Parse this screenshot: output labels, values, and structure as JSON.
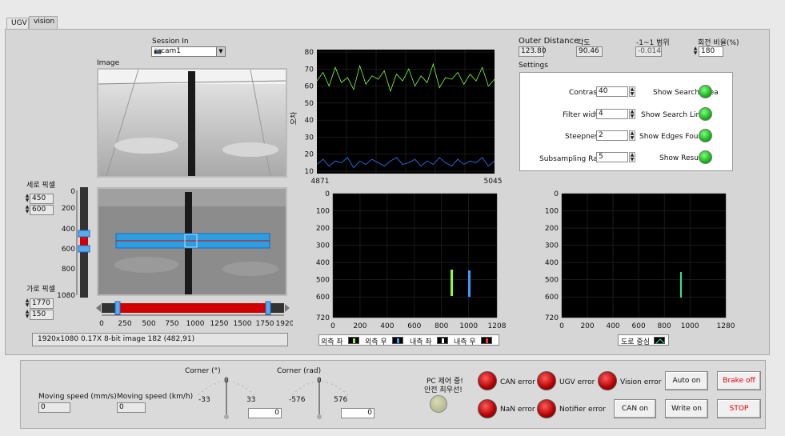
{
  "tabs": [
    {
      "label": "UGV"
    },
    {
      "label": "vision"
    }
  ],
  "session": {
    "label": "Session In",
    "value": "cam1",
    "icon": "camera-icon"
  },
  "image_label": "Image",
  "vertical_pixel": {
    "label": "세로 픽셀",
    "v1": "450",
    "v2": "600"
  },
  "horizontal_pixel": {
    "label": "가로 픽셀",
    "v1": "1770",
    "v2": "150"
  },
  "vslider": {
    "ticks": [
      "0",
      "200",
      "400",
      "600",
      "800",
      "1080"
    ]
  },
  "hslider": {
    "ticks": [
      "0",
      "250",
      "500",
      "750",
      "1000",
      "1250",
      "1500",
      "1750",
      "1920"
    ]
  },
  "status_bar": "1920x1080 0.17X 8-bit image 182    (482,91)",
  "top_chart": {
    "ylabel": "오차",
    "yticks": [
      "80",
      "70",
      "60",
      "50",
      "40",
      "30",
      "20",
      "10"
    ],
    "xmin": "4871",
    "xmax": "5045"
  },
  "chart_data": [
    {
      "type": "line",
      "ylabel": "오차",
      "ylim": [
        10,
        80
      ],
      "xlim": [
        4871,
        5045
      ],
      "series": [
        {
          "color": "#7dff3a",
          "values": [
            63,
            68,
            60,
            71,
            62,
            65,
            58,
            72,
            61,
            66,
            64,
            69,
            57,
            67,
            63,
            70,
            60,
            66,
            62,
            73,
            59,
            65,
            64,
            68,
            61,
            67,
            63,
            71,
            60,
            64
          ]
        },
        {
          "color": "#2a7dff",
          "values": [
            14,
            17,
            13,
            16,
            15,
            18,
            12,
            16,
            14,
            17,
            15,
            13,
            16,
            18,
            14,
            15,
            17,
            13,
            16,
            14,
            18,
            15,
            13,
            17,
            14,
            16,
            15,
            18,
            13,
            16
          ]
        }
      ]
    },
    {
      "type": "scatter",
      "ylim": [
        720,
        0
      ],
      "xlim": [
        0,
        1208
      ],
      "yticks": [
        "0",
        "100",
        "200",
        "300",
        "400",
        "500",
        "600",
        "720"
      ],
      "xticks": [
        "0",
        "200",
        "400",
        "600",
        "800",
        "1000",
        "1208"
      ],
      "legend": [
        "외측 좌",
        "외측 우",
        "내측 좌",
        "내측 우"
      ]
    },
    {
      "type": "scatter",
      "ylim": [
        720,
        0
      ],
      "xlim": [
        0,
        1280
      ],
      "yticks": [
        "0",
        "100",
        "200",
        "300",
        "400",
        "500",
        "600",
        "720"
      ],
      "xticks": [
        "0",
        "200",
        "400",
        "600",
        "800",
        "1000",
        "1280"
      ],
      "legend": [
        "도로 중심"
      ]
    }
  ],
  "top_right": {
    "outer_label": "Outer Distance",
    "outer_value": "123.80",
    "angle_label": "각도",
    "angle_value": "90.46",
    "range_label": "-1~1 범위",
    "range_value": "-0.014",
    "ratio_label": "회전 비율(%)",
    "ratio_value": "180"
  },
  "settings": {
    "title": "Settings",
    "contrast_label": "Contrast",
    "contrast": "40",
    "filter_label": "Filter width",
    "filter": "4",
    "steep_label": "Steepness",
    "steep": "2",
    "sub_label": "Subsampling Ratio",
    "sub": "5",
    "show_area": "Show Search Area",
    "show_lines": "Show Search Lines",
    "show_edges": "Show Edges Found",
    "show_result": "Show Result"
  },
  "bottom": {
    "moving_mm_label": "Moving speed (mm/s)",
    "moving_mm": "0",
    "moving_km_label": "Moving speed (km/h)",
    "moving_km": "0",
    "corner_deg_label": "Corner (°)",
    "corner_rad_label": "Corner (rad)",
    "deg_min": "-33",
    "deg_mid": "0",
    "deg_max": "33",
    "rad_min": "-576",
    "rad_mid": "0",
    "rad_max": "576",
    "deg_value": "0",
    "rad_value": "0",
    "pc_label1": "PC 제어 중!",
    "pc_label2": "안전 최우선!"
  },
  "errors": {
    "can": "CAN error",
    "ugv": "UGV error",
    "vision": "Vision error",
    "nan": "NaN error",
    "notifier": "Notifier error"
  },
  "buttons": {
    "auto": "Auto on",
    "brake": "Brake off",
    "can_on": "CAN on",
    "write": "Write on",
    "stop": "STOP"
  }
}
